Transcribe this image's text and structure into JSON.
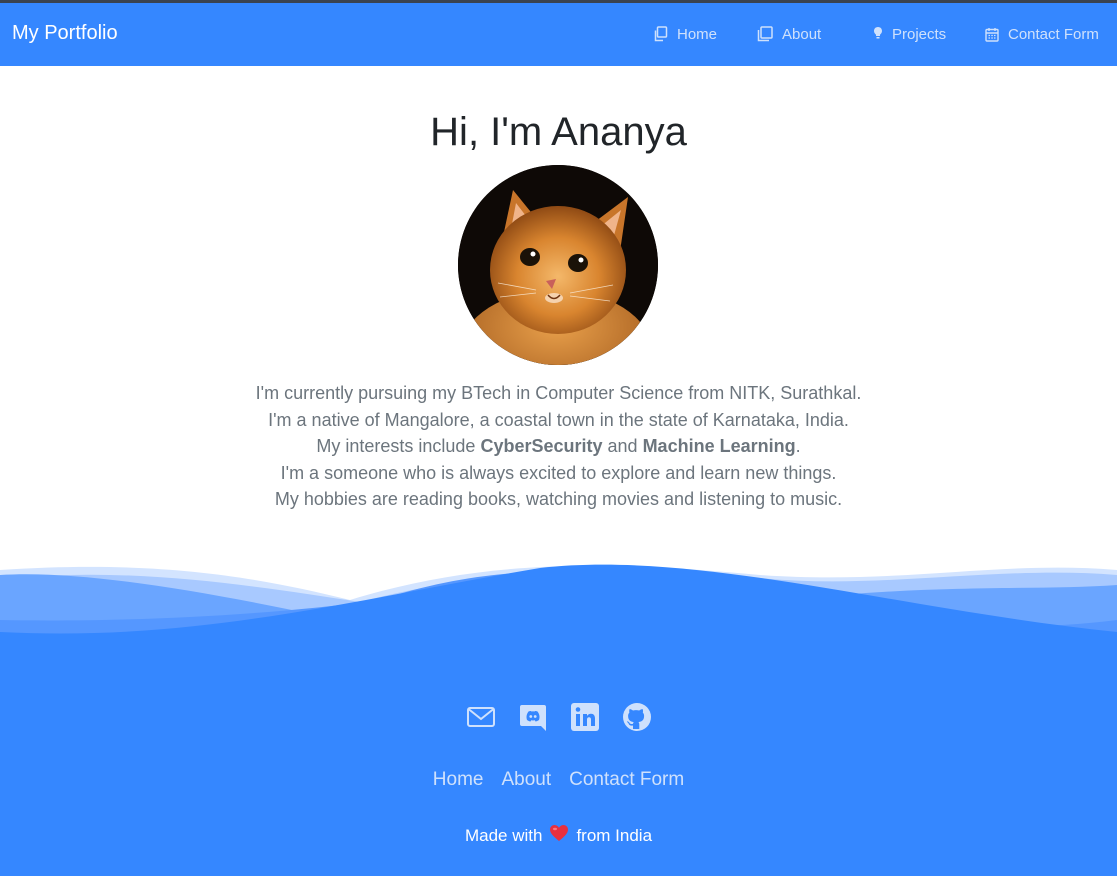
{
  "colors": {
    "primary": "#3587ff",
    "nav_text": "#cfe1fc",
    "body_text": "#6c757d",
    "heart": "#e8303f"
  },
  "navbar": {
    "brand": "My Portfolio",
    "links": [
      {
        "label": "Home",
        "icon": "copy-icon"
      },
      {
        "label": "About",
        "icon": "pages-icon"
      },
      {
        "label": "Projects",
        "icon": "bulb-icon"
      },
      {
        "label": "Contact Form",
        "icon": "calendar-icon"
      }
    ]
  },
  "hero": {
    "title": "Hi, I'm Ananya",
    "avatar": "kitten-photo",
    "bio": {
      "line1": "I'm currently pursuing my BTech in Computer Science from NITK, Surathkal.",
      "line2": "I'm a native of Mangalore, a coastal town in the state of Karnataka, India.",
      "line3_prefix": "My interests include ",
      "line3_bold1": "CyberSecurity",
      "line3_mid": " and ",
      "line3_bold2": "Machine Learning",
      "line3_suffix": ".",
      "line4": "I'm a someone who is always excited to explore and learn new things.",
      "line5": "My hobbies are reading books, watching movies and listening to music."
    }
  },
  "footer": {
    "social_icons": [
      "mail-icon",
      "discord-icon",
      "linkedin-icon",
      "github-icon"
    ],
    "links": [
      "Home",
      "About",
      "Contact Form"
    ],
    "made_prefix": "Made with",
    "made_suffix": "from India"
  }
}
